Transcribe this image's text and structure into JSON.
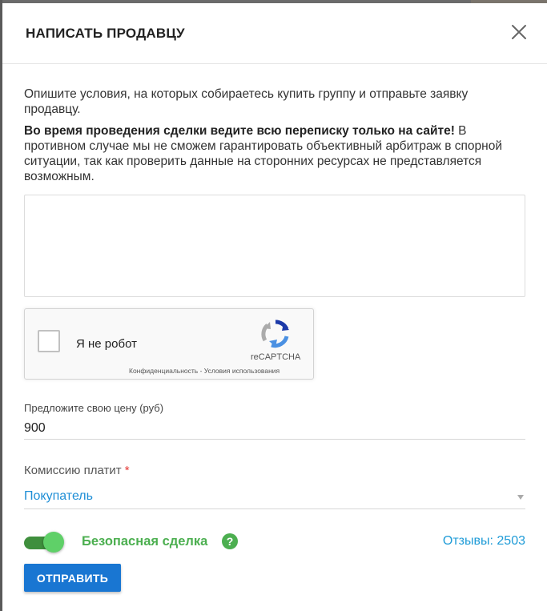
{
  "modal": {
    "title": "НАПИСАТЬ ПРОДАВЦУ",
    "description": "Опишите условия, на которых собираетесь купить группу и отправьте заявку продавцу.",
    "warning_bold": "Во время проведения сделки ведите всю переписку только на сайте!",
    "warning_rest": " В противном случае мы не сможем гарантировать объективный арбитраж в спорной ситуации, так как проверить данные на сторонних ресурсах не представляется возможным.",
    "message_value": "",
    "captcha": {
      "label": "Я не робот",
      "brand": "reCAPTCHA",
      "links": "Конфиденциальность - Условия использования"
    },
    "price": {
      "label": "Предложите свою цену (руб)",
      "value": "900"
    },
    "fee": {
      "label": "Комиссию платит",
      "required_mark": "*",
      "selected": "Покупатель"
    },
    "safe_deal": {
      "label": "Безопасная сделка",
      "enabled": true,
      "help": "?"
    },
    "reviews": "Отзывы: 2503",
    "submit": "ОТПРАВИТЬ"
  },
  "colors": {
    "accent": "#1976d2",
    "link": "#1e9bd7",
    "success": "#4caf50",
    "required": "#e53935"
  }
}
